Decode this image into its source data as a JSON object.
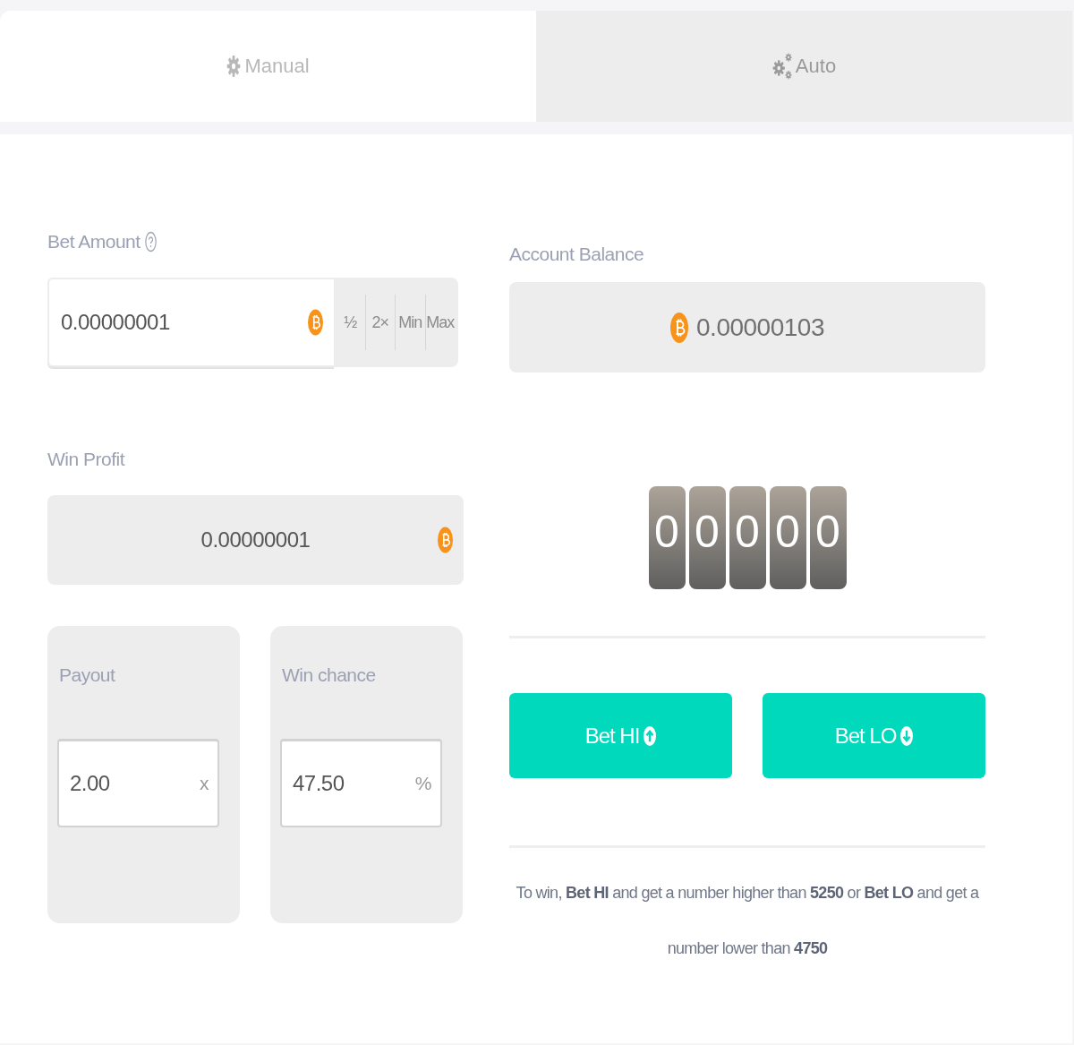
{
  "tabs": [
    {
      "label": "Manual",
      "kind": "gear",
      "selected": true
    },
    {
      "label": "Auto",
      "kind": "gears",
      "selected": false
    }
  ],
  "bet_amount": {
    "label": "Bet Amount",
    "value": "0.00000001",
    "shortcuts": [
      "½",
      "2×",
      "Min",
      "Max"
    ]
  },
  "win_profit": {
    "label": "Win Profit",
    "value": "0.00000001"
  },
  "rate_fields": [
    {
      "label": "Payout",
      "value": "2.00",
      "suffix": "x"
    },
    {
      "label": "Win chance",
      "value": "47.50",
      "suffix": "%"
    }
  ],
  "account_balance": {
    "label": "Account Balance",
    "value": "0.00000103"
  },
  "roll_digits": [
    "0",
    "0",
    "0",
    "0",
    "0"
  ],
  "bet_buttons": [
    {
      "label": "Bet HI",
      "kind": "up"
    },
    {
      "label": "Bet LO",
      "kind": "down"
    }
  ],
  "rules_text": "To win, **Bet HI** and get a number higher than **5250** or **Bet LO** and get a number lower than **4750**"
}
